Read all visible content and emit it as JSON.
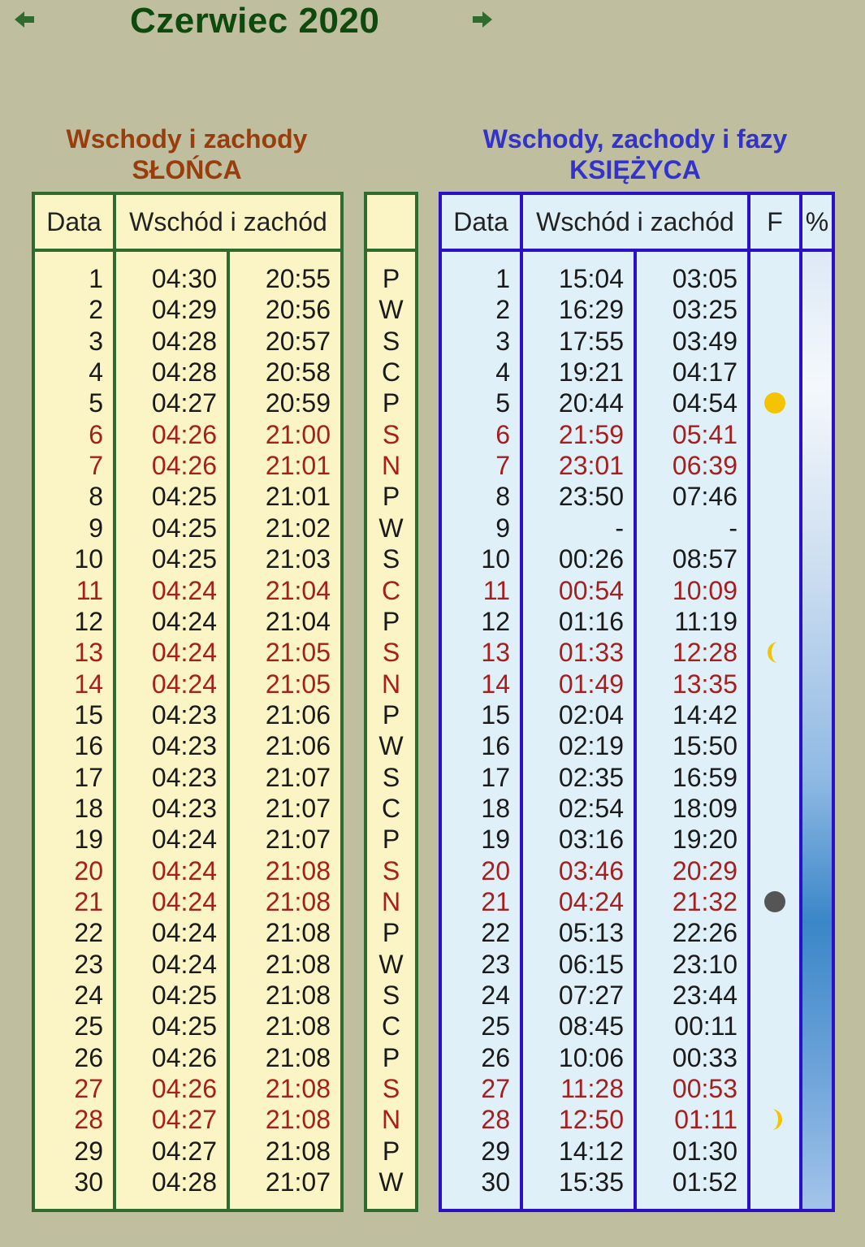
{
  "title": "Czerwiec 2020",
  "nav": {
    "prev_icon": "arrow-left-icon",
    "next_icon": "arrow-right-icon"
  },
  "sun": {
    "heading_line1": "Wschody i zachody",
    "heading_line2": "SŁOŃCA",
    "col_date": "Data",
    "col_riseset": "Wschód i zachód"
  },
  "moon": {
    "heading_line1": "Wschody, zachody i fazy",
    "heading_line2": "KSIĘŻYCA",
    "col_date": "Data",
    "col_riseset": "Wschód i zachód",
    "col_phase": "F",
    "col_percent": "%"
  },
  "colors": {
    "holiday": "#a61e1e",
    "sun_border": "#2f6b2f",
    "moon_border": "#2a10c8"
  },
  "phases": [
    {
      "day": 5,
      "icon": "full-moon-icon"
    },
    {
      "day": 13,
      "icon": "last-quarter-icon"
    },
    {
      "day": 21,
      "icon": "new-moon-icon"
    },
    {
      "day": 28,
      "icon": "first-quarter-icon"
    }
  ],
  "rows": [
    {
      "d": "1",
      "sr": "04:30",
      "ss": "20:55",
      "w": "P",
      "mr": "15:04",
      "ms": "03:05",
      "h": false
    },
    {
      "d": "2",
      "sr": "04:29",
      "ss": "20:56",
      "w": "W",
      "mr": "16:29",
      "ms": "03:25",
      "h": false
    },
    {
      "d": "3",
      "sr": "04:28",
      "ss": "20:57",
      "w": "S",
      "mr": "17:55",
      "ms": "03:49",
      "h": false
    },
    {
      "d": "4",
      "sr": "04:28",
      "ss": "20:58",
      "w": "C",
      "mr": "19:21",
      "ms": "04:17",
      "h": false
    },
    {
      "d": "5",
      "sr": "04:27",
      "ss": "20:59",
      "w": "P",
      "mr": "20:44",
      "ms": "04:54",
      "h": false
    },
    {
      "d": "6",
      "sr": "04:26",
      "ss": "21:00",
      "w": "S",
      "mr": "21:59",
      "ms": "05:41",
      "h": true
    },
    {
      "d": "7",
      "sr": "04:26",
      "ss": "21:01",
      "w": "N",
      "mr": "23:01",
      "ms": "06:39",
      "h": true
    },
    {
      "d": "8",
      "sr": "04:25",
      "ss": "21:01",
      "w": "P",
      "mr": "23:50",
      "ms": "07:46",
      "h": false
    },
    {
      "d": "9",
      "sr": "04:25",
      "ss": "21:02",
      "w": "W",
      "mr": "-",
      "ms": "-",
      "h": false
    },
    {
      "d": "10",
      "sr": "04:25",
      "ss": "21:03",
      "w": "S",
      "mr": "00:26",
      "ms": "08:57",
      "h": false
    },
    {
      "d": "11",
      "sr": "04:24",
      "ss": "21:04",
      "w": "C",
      "mr": "00:54",
      "ms": "10:09",
      "h": true
    },
    {
      "d": "12",
      "sr": "04:24",
      "ss": "21:04",
      "w": "P",
      "mr": "01:16",
      "ms": "11:19",
      "h": false
    },
    {
      "d": "13",
      "sr": "04:24",
      "ss": "21:05",
      "w": "S",
      "mr": "01:33",
      "ms": "12:28",
      "h": true
    },
    {
      "d": "14",
      "sr": "04:24",
      "ss": "21:05",
      "w": "N",
      "mr": "01:49",
      "ms": "13:35",
      "h": true
    },
    {
      "d": "15",
      "sr": "04:23",
      "ss": "21:06",
      "w": "P",
      "mr": "02:04",
      "ms": "14:42",
      "h": false
    },
    {
      "d": "16",
      "sr": "04:23",
      "ss": "21:06",
      "w": "W",
      "mr": "02:19",
      "ms": "15:50",
      "h": false
    },
    {
      "d": "17",
      "sr": "04:23",
      "ss": "21:07",
      "w": "S",
      "mr": "02:35",
      "ms": "16:59",
      "h": false
    },
    {
      "d": "18",
      "sr": "04:23",
      "ss": "21:07",
      "w": "C",
      "mr": "02:54",
      "ms": "18:09",
      "h": false
    },
    {
      "d": "19",
      "sr": "04:24",
      "ss": "21:07",
      "w": "P",
      "mr": "03:16",
      "ms": "19:20",
      "h": false
    },
    {
      "d": "20",
      "sr": "04:24",
      "ss": "21:08",
      "w": "S",
      "mr": "03:46",
      "ms": "20:29",
      "h": true
    },
    {
      "d": "21",
      "sr": "04:24",
      "ss": "21:08",
      "w": "N",
      "mr": "04:24",
      "ms": "21:32",
      "h": true
    },
    {
      "d": "22",
      "sr": "04:24",
      "ss": "21:08",
      "w": "P",
      "mr": "05:13",
      "ms": "22:26",
      "h": false
    },
    {
      "d": "23",
      "sr": "04:24",
      "ss": "21:08",
      "w": "W",
      "mr": "06:15",
      "ms": "23:10",
      "h": false
    },
    {
      "d": "24",
      "sr": "04:25",
      "ss": "21:08",
      "w": "S",
      "mr": "07:27",
      "ms": "23:44",
      "h": false
    },
    {
      "d": "25",
      "sr": "04:25",
      "ss": "21:08",
      "w": "C",
      "mr": "08:45",
      "ms": "00:11",
      "h": false
    },
    {
      "d": "26",
      "sr": "04:26",
      "ss": "21:08",
      "w": "P",
      "mr": "10:06",
      "ms": "00:33",
      "h": false
    },
    {
      "d": "27",
      "sr": "04:26",
      "ss": "21:08",
      "w": "S",
      "mr": "11:28",
      "ms": "00:53",
      "h": true
    },
    {
      "d": "28",
      "sr": "04:27",
      "ss": "21:08",
      "w": "N",
      "mr": "12:50",
      "ms": "01:11",
      "h": true
    },
    {
      "d": "29",
      "sr": "04:27",
      "ss": "21:08",
      "w": "P",
      "mr": "14:12",
      "ms": "01:30",
      "h": false
    },
    {
      "d": "30",
      "sr": "04:28",
      "ss": "21:07",
      "w": "W",
      "mr": "15:35",
      "ms": "01:52",
      "h": false
    }
  ]
}
